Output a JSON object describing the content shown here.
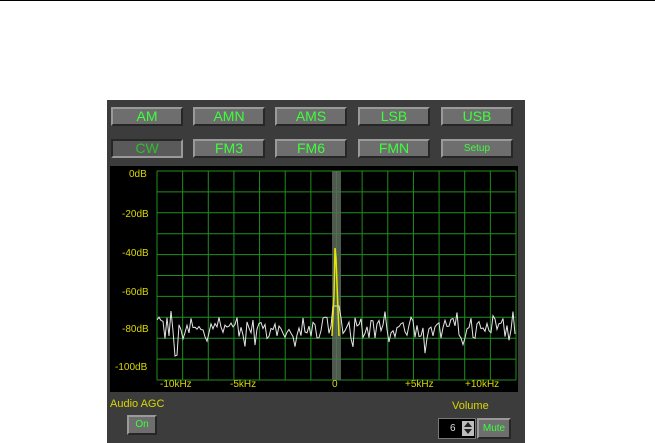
{
  "modes_row1": [
    "AM",
    "AMN",
    "AMS",
    "LSB",
    "USB"
  ],
  "modes_row2": [
    "CW",
    "FM3",
    "FM6",
    "FMN",
    "Setup"
  ],
  "active_mode": "CW",
  "db_labels": [
    "0dB",
    "-20dB",
    "-40dB",
    "-60dB",
    "-80dB",
    "-100dB"
  ],
  "freq_labels": [
    "-10kHz",
    "-5kHz",
    "0",
    "+5kHz",
    "+10kHz"
  ],
  "audio_agc": {
    "label": "Audio AGC",
    "button": "On"
  },
  "volume": {
    "label": "Volume",
    "value": "6",
    "mute_label": "Mute"
  },
  "colors": {
    "grid": "#1f8f1f",
    "trace": "#e6e6e6",
    "signal": "#e6e600",
    "label": "#d8d800",
    "button_text": "#3cff3c"
  }
}
